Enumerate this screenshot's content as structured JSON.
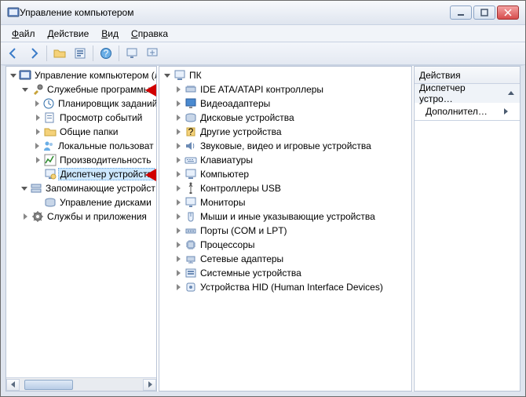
{
  "window": {
    "title": "Управление компьютером"
  },
  "menubar": {
    "items": [
      {
        "label": "Файл",
        "accel": 0
      },
      {
        "label": "Действие",
        "accel": 0
      },
      {
        "label": "Вид",
        "accel": 0
      },
      {
        "label": "Справка",
        "accel": 0
      }
    ]
  },
  "toolbar": {
    "icons": [
      "back-icon",
      "forward-icon",
      "divider",
      "up-icon",
      "properties-icon",
      "divider",
      "help-icon",
      "divider",
      "refresh-icon",
      "monitor-icon"
    ]
  },
  "left_tree": {
    "root": {
      "label": "Управление компьютером (л",
      "icon": "mmc-icon"
    },
    "nodes": [
      {
        "label": "Служебные программы",
        "icon": "tools-icon",
        "expanded": true,
        "children": [
          {
            "label": "Планировщик заданий",
            "icon": "scheduler-icon"
          },
          {
            "label": "Просмотр событий",
            "icon": "eventlog-icon"
          },
          {
            "label": "Общие папки",
            "icon": "sharedfolders-icon"
          },
          {
            "label": "Локальные пользоват",
            "icon": "users-icon"
          },
          {
            "label": "Производительность",
            "icon": "perf-icon"
          },
          {
            "label": "Диспетчер устройств",
            "icon": "devmgr-icon",
            "selected": true
          }
        ]
      },
      {
        "label": "Запоминающие устройст",
        "icon": "storage-icon",
        "expanded": true,
        "children": [
          {
            "label": "Управление дисками",
            "icon": "diskmgmt-icon"
          }
        ]
      },
      {
        "label": "Службы и приложения",
        "icon": "services-icon",
        "expanded": false
      }
    ]
  },
  "mid_tree": {
    "root": {
      "label": "ПК",
      "icon": "computer-icon",
      "expanded": true
    },
    "children": [
      {
        "label": "IDE ATA/ATAPI контроллеры",
        "icon": "ide-icon"
      },
      {
        "label": "Видеоадаптеры",
        "icon": "display-icon"
      },
      {
        "label": "Дисковые устройства",
        "icon": "disk-icon"
      },
      {
        "label": "Другие устройства",
        "icon": "other-icon"
      },
      {
        "label": "Звуковые, видео и игровые устройства",
        "icon": "sound-icon"
      },
      {
        "label": "Клавиатуры",
        "icon": "keyboard-icon"
      },
      {
        "label": "Компьютер",
        "icon": "computer-icon"
      },
      {
        "label": "Контроллеры USB",
        "icon": "usb-icon"
      },
      {
        "label": "Мониторы",
        "icon": "monitor-icon"
      },
      {
        "label": "Мыши и иные указывающие устройства",
        "icon": "mouse-icon"
      },
      {
        "label": "Порты (COM и LPT)",
        "icon": "port-icon"
      },
      {
        "label": "Процессоры",
        "icon": "cpu-icon"
      },
      {
        "label": "Сетевые адаптеры",
        "icon": "network-icon"
      },
      {
        "label": "Системные устройства",
        "icon": "system-icon"
      },
      {
        "label": "Устройства HID (Human Interface Devices)",
        "icon": "hid-icon"
      }
    ]
  },
  "actions": {
    "header": "Действия",
    "group_title": "Диспетчер устро…",
    "more_link": "Дополнител…"
  }
}
